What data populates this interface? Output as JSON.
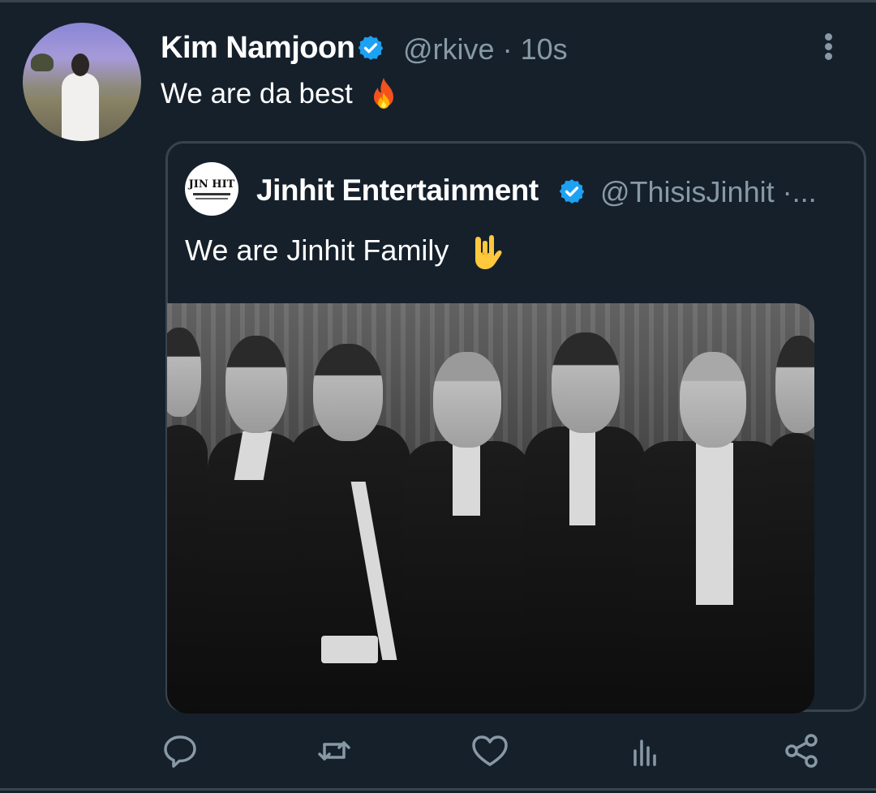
{
  "tweet": {
    "author_name": "Kim Namjoon",
    "handle": "@rkive",
    "separator": "·",
    "time": "10s",
    "text": "We are da best",
    "emoji": "fire"
  },
  "quoted_tweet": {
    "author_name": "Jinhit Entertainment",
    "handle": "@ThisisJinhit ·...",
    "text": "We are Jinhit Family",
    "emoji": "sign-of-the-horns",
    "avatar_logo": "JIN HIT",
    "media_description": ""
  },
  "actions": [
    {
      "icon": "reply-icon"
    },
    {
      "icon": "retweet-icon"
    },
    {
      "icon": "like-icon"
    },
    {
      "icon": "analytics-icon"
    },
    {
      "icon": "share-icon"
    }
  ],
  "colors": {
    "background": "#15202b",
    "verified": "#1da1f2",
    "secondary_text": "#8899a6",
    "border": "#38444d"
  }
}
